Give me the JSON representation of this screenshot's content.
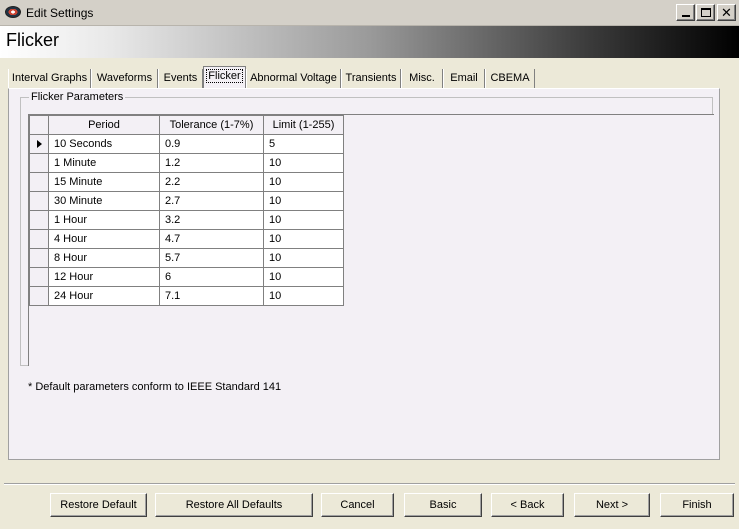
{
  "window": {
    "title": "Edit Settings"
  },
  "banner": {
    "title": "Flicker"
  },
  "tabs": [
    {
      "label": "Interval Graphs"
    },
    {
      "label": "Waveforms"
    },
    {
      "label": "Events"
    },
    {
      "label": "Flicker",
      "active": true
    },
    {
      "label": "Abnormal Voltage"
    },
    {
      "label": "Transients"
    },
    {
      "label": "Misc."
    },
    {
      "label": "Email"
    },
    {
      "label": "CBEMA"
    }
  ],
  "flicker": {
    "group_label": "Flicker Parameters",
    "columns": [
      "Period",
      "Tolerance (1-7%)",
      "Limit (1-255)"
    ],
    "rows": [
      {
        "period": "10 Seconds",
        "tolerance": "0.9",
        "limit": "5",
        "current": true
      },
      {
        "period": "1 Minute",
        "tolerance": "1.2",
        "limit": "10"
      },
      {
        "period": "15 Minute",
        "tolerance": "2.2",
        "limit": "10"
      },
      {
        "period": "30 Minute",
        "tolerance": "2.7",
        "limit": "10"
      },
      {
        "period": "1 Hour",
        "tolerance": "3.2",
        "limit": "10"
      },
      {
        "period": "4 Hour",
        "tolerance": "4.7",
        "limit": "10"
      },
      {
        "period": "8 Hour",
        "tolerance": "5.7",
        "limit": "10"
      },
      {
        "period": "12 Hour",
        "tolerance": "6",
        "limit": "10"
      },
      {
        "period": "24 Hour",
        "tolerance": "7.1",
        "limit": "10"
      }
    ],
    "footnote": "* Default parameters conform to IEEE Standard 141"
  },
  "buttons": {
    "restore_default": "Restore Default",
    "restore_all_defaults": "Restore All Defaults",
    "cancel": "Cancel",
    "basic": "Basic",
    "back": "< Back",
    "next": "Next >",
    "finish": "Finish"
  },
  "icons": {
    "app": "app-icon",
    "minimize": "minimize-icon",
    "maximize": "maximize-icon",
    "close": "close-icon",
    "current_row": "current-row-arrow-icon"
  }
}
